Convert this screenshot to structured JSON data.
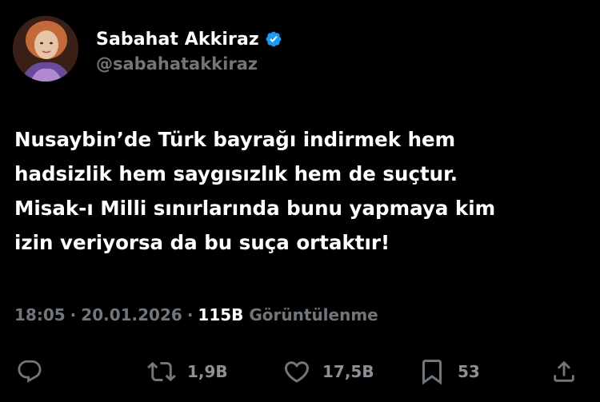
{
  "user": {
    "display_name": "Sabahat Akkiraz",
    "handle": "@sabahatakkiraz",
    "verified": true
  },
  "tweet": {
    "lines": [
      "Nusaybin’de Türk bayrağı indirmek hem",
      "hadsizlik hem saygısızlık hem de suçtur.",
      "Misak-ı Milli sınırlarında bunu yapmaya kim",
      "izin veriyorsa da bu suça ortaktır!"
    ]
  },
  "meta": {
    "time": "18:05",
    "separator": "·",
    "date": "20.01.2026",
    "views_count": "115B",
    "views_label": "Görüntülenme"
  },
  "actions": {
    "reply": {
      "icon": "reply-icon",
      "count": ""
    },
    "retweet": {
      "icon": "retweet-icon",
      "count": "1,9B"
    },
    "like": {
      "icon": "heart-icon",
      "count": "17,5B"
    },
    "bookmark": {
      "icon": "bookmark-icon",
      "count": "53"
    },
    "share": {
      "icon": "share-icon"
    }
  },
  "colors": {
    "background": "#000000",
    "text": "#ffffff",
    "secondary": "#71767b",
    "verified": "#1d9bf0"
  }
}
